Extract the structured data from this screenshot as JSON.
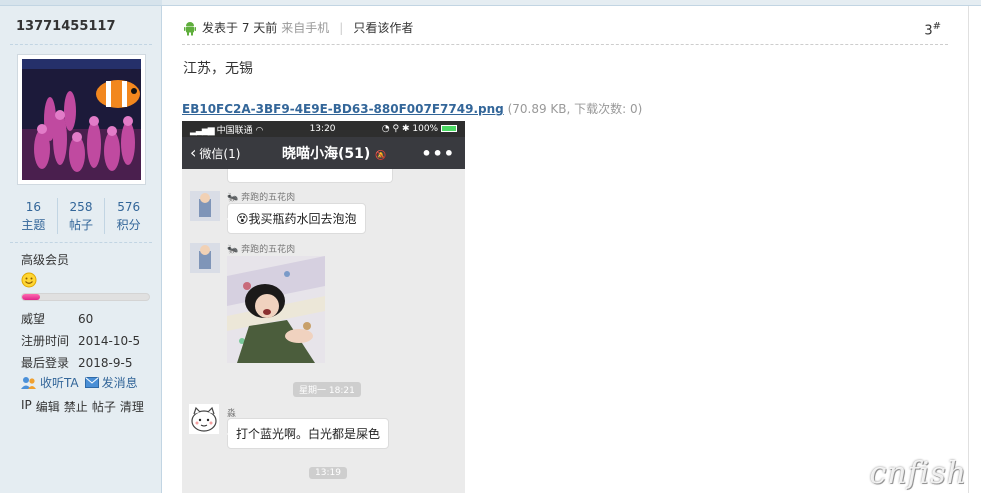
{
  "user": {
    "username": "13771455117",
    "stats": [
      {
        "num": "16",
        "label": "主题"
      },
      {
        "num": "258",
        "label": "帖子"
      },
      {
        "num": "576",
        "label": "积分"
      }
    ],
    "group": "高级会员",
    "progress": 0.14,
    "info": [
      {
        "k": "威望",
        "v": "60"
      },
      {
        "k": "注册时间",
        "v": "2014-10-5"
      },
      {
        "k": "最后登录",
        "v": "2018-9-5"
      }
    ],
    "actions": {
      "follow": "收听TA",
      "message": "发消息"
    },
    "admin": [
      "IP",
      "编辑",
      "禁止",
      "帖子",
      "清理"
    ]
  },
  "post": {
    "posted": "发表于 7 天前",
    "from": "来自手机",
    "only_author": "只看该作者",
    "floor": "3",
    "floor_mark": "#",
    "message": "江苏，无锡",
    "attachment": {
      "filename": "EB10FC2A-3BF9-4E9E-BD63-880F007F7749.png",
      "meta": "(70.89 KB, 下载次数: 0)"
    }
  },
  "phone": {
    "carrier": "中国联通",
    "time": "13:20",
    "battery": "100%",
    "back": "微信(1)",
    "chat_title": "晓喵小海(51)",
    "sender1": "奔跑的五花肉",
    "msg1": "我买瓶药水回去泡泡",
    "sender2": "奔跑的五花肉",
    "time1": "星期一 18:21",
    "sender3": "淼",
    "msg2": "打个蓝光啊。白光都是屎色",
    "time2": "13:19"
  },
  "watermark": "cnfish",
  "colors": {
    "link": "#336699",
    "sidebar_bg": "#e5edf2",
    "bar_fill": "#e0248a"
  }
}
